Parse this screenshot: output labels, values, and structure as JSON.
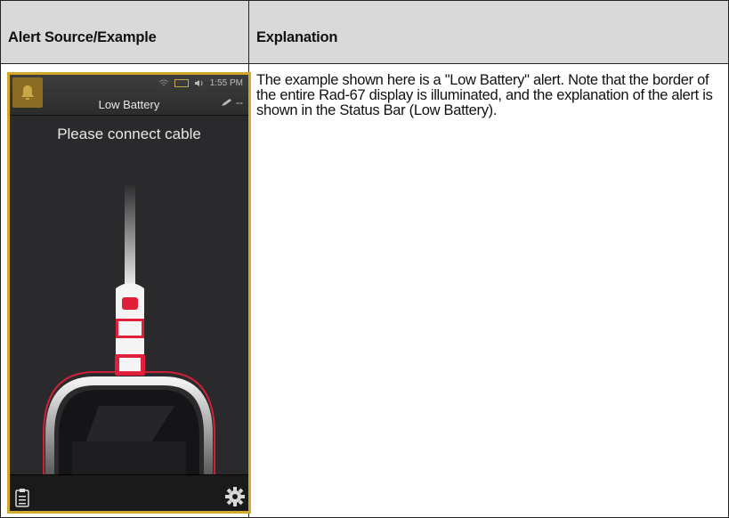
{
  "table": {
    "header_col1": "Alert Source/Example",
    "header_col2": "Explanation",
    "explanation": "The example shown here is a \"Low Battery\" alert. Note that the border of the entire Rad-67 display is illuminated, and the explanation of the alert is shown in the Status Bar (Low Battery)."
  },
  "device": {
    "time": "1:55 PM",
    "status_title": "Low Battery",
    "status_right": "--",
    "prompt": "Please connect cable",
    "border_color": "#d4a82a",
    "cable_accent": "#e0203a",
    "icons": [
      "bell-icon",
      "wifi-icon",
      "battery-icon",
      "speaker-icon",
      "pen-icon",
      "clipboard-icon",
      "gear-icon"
    ]
  }
}
